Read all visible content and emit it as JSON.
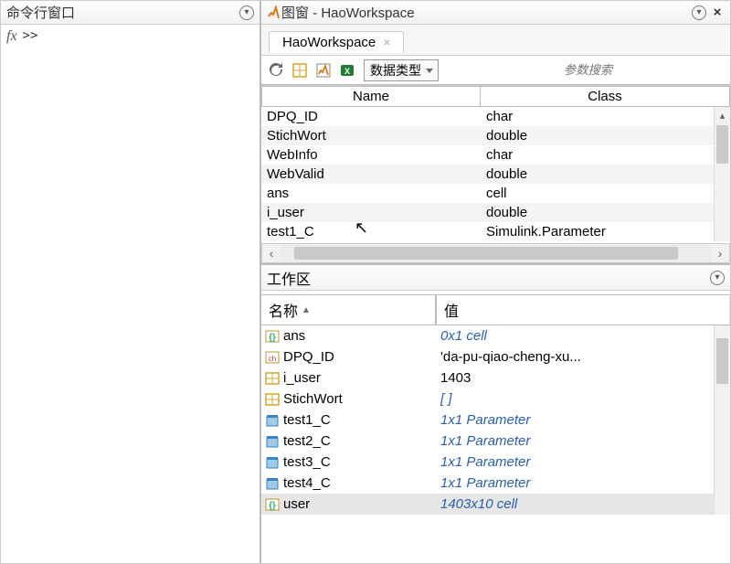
{
  "left": {
    "title": "命令行窗口",
    "prompt": ">>"
  },
  "right": {
    "header_prefix": "图窗 - ",
    "header_name": "HaoWorkspace",
    "tab": "HaoWorkspace",
    "filter_label": "数据类型",
    "search_placeholder": "参数搜索",
    "cols": {
      "name": "Name",
      "class": "Class"
    },
    "rows": [
      {
        "name": "DPQ_ID",
        "class": "char"
      },
      {
        "name": "StichWort",
        "class": "double"
      },
      {
        "name": "WebInfo",
        "class": "char"
      },
      {
        "name": "WebValid",
        "class": "double"
      },
      {
        "name": "ans",
        "class": "cell"
      },
      {
        "name": "i_user",
        "class": "double"
      },
      {
        "name": "test1_C",
        "class": "Simulink.Parameter"
      }
    ]
  },
  "workspace": {
    "title": "工作区",
    "cols": {
      "name": "名称",
      "val": "值"
    },
    "sort_indicator": "▲",
    "rows": [
      {
        "icon": "cell",
        "name": "ans",
        "val": "0x1 cell",
        "italic": true
      },
      {
        "icon": "char",
        "name": "DPQ_ID",
        "val": "'da-pu-qiao-cheng-xu...",
        "italic": false
      },
      {
        "icon": "num",
        "name": "i_user",
        "val": "1403",
        "italic": false
      },
      {
        "icon": "num",
        "name": "StichWort",
        "val": "[ ]",
        "italic": true
      },
      {
        "icon": "obj",
        "name": "test1_C",
        "val": "1x1 Parameter",
        "italic": true
      },
      {
        "icon": "obj",
        "name": "test2_C",
        "val": "1x1 Parameter",
        "italic": true
      },
      {
        "icon": "obj",
        "name": "test3_C",
        "val": "1x1 Parameter",
        "italic": true
      },
      {
        "icon": "obj",
        "name": "test4_C",
        "val": "1x1 Parameter",
        "italic": true
      },
      {
        "icon": "cell",
        "name": "user",
        "val": "1403x10 cell",
        "italic": true
      }
    ]
  }
}
